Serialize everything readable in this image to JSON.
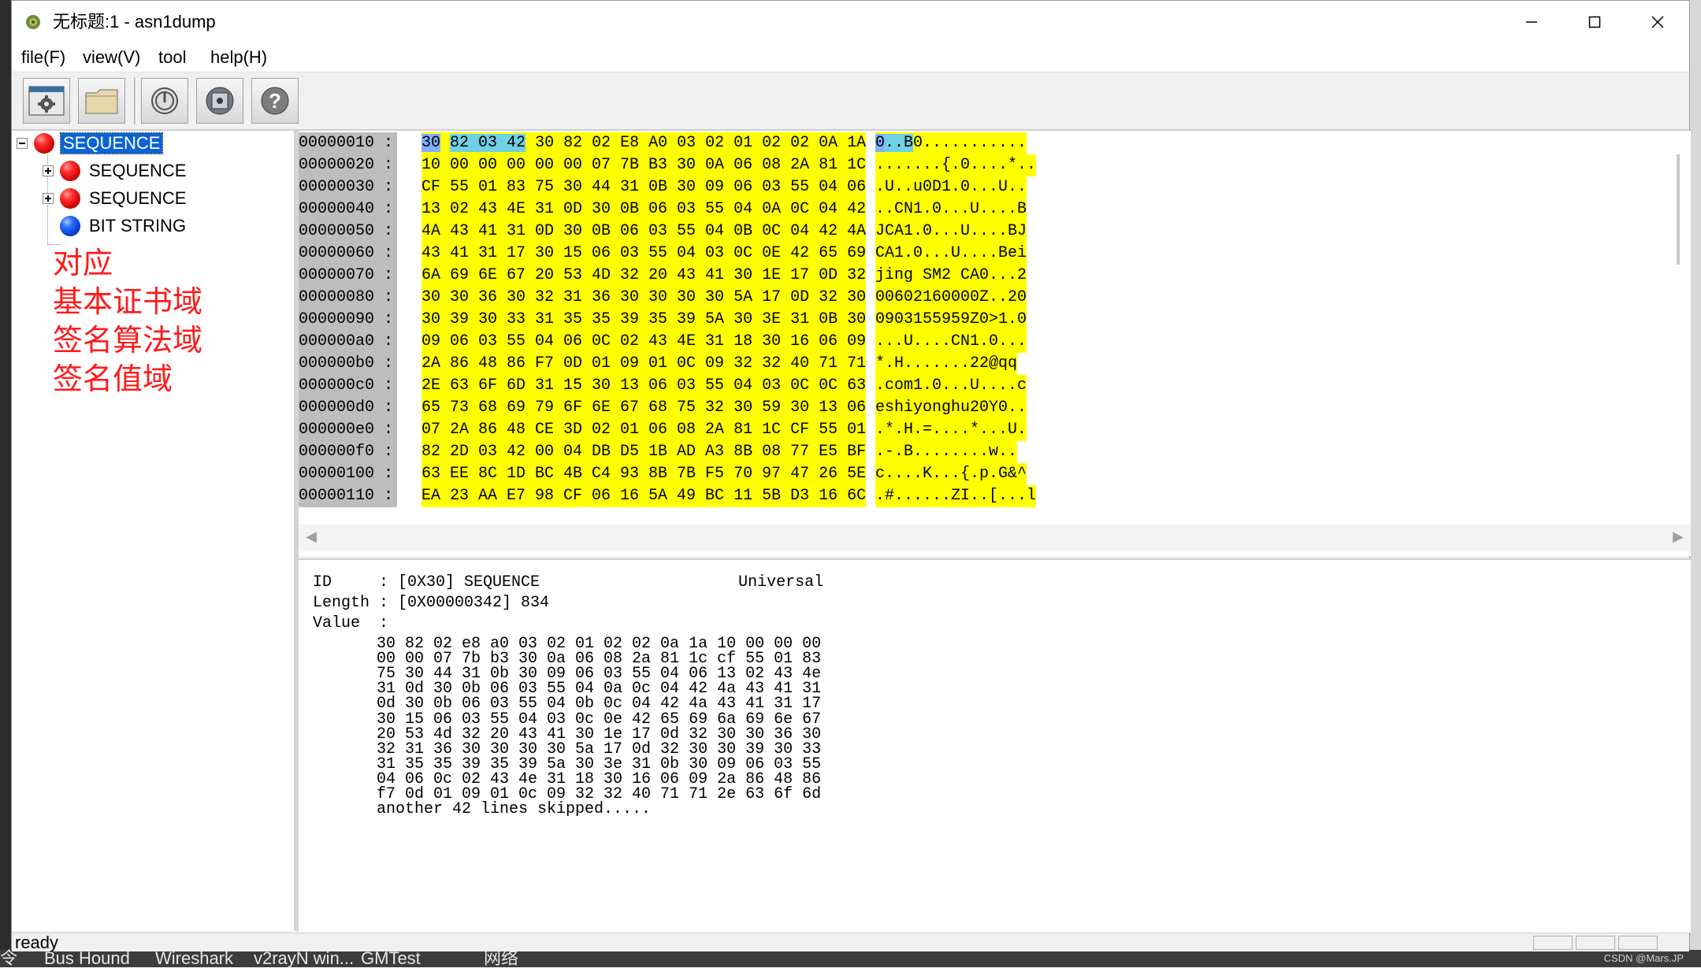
{
  "window": {
    "title": "无标题:1 - asn1dump"
  },
  "menu": [
    {
      "label": "file(F)"
    },
    {
      "label": "view(V)"
    },
    {
      "label": "tool"
    },
    {
      "label": "help(H)"
    }
  ],
  "toolbar": {
    "icons": [
      "window-settings-icon",
      "open-folder-icon",
      "power-icon",
      "disk-icon",
      "help-icon"
    ]
  },
  "tree": {
    "root": {
      "label": "SEQUENCE",
      "icon": "red-ball-icon",
      "expanded": true,
      "selected": true
    },
    "children": [
      {
        "label": "SEQUENCE",
        "icon": "red-ball-icon",
        "expandable": true
      },
      {
        "label": "SEQUENCE",
        "icon": "red-ball-icon",
        "expandable": true
      },
      {
        "label": "BIT STRING",
        "icon": "blue-ball-icon",
        "expandable": false
      }
    ]
  },
  "annotations": [
    "对应",
    "基本证书域",
    "签名算法域",
    "签名值域"
  ],
  "hex": {
    "rows": [
      {
        "addr": "00000010 :",
        "b1": "30",
        "b2": "82 03 42",
        "rest": "30 82 02 E8 A0 03 02 01 02 02 0A 1A",
        "a1": "0",
        "a2": "..B",
        "arest": "0..........."
      },
      {
        "addr": "00000020 :",
        "bytes": "10 00 00 00 00 00 07 7B B3 30 0A 06 08 2A 81 1C",
        "ascii": ".......{.0....*.."
      },
      {
        "addr": "00000030 :",
        "bytes": "CF 55 01 83 75 30 44 31 0B 30 09 06 03 55 04 06",
        "ascii": ".U..u0D1.0...U.."
      },
      {
        "addr": "00000040 :",
        "bytes": "13 02 43 4E 31 0D 30 0B 06 03 55 04 0A 0C 04 42",
        "ascii": "..CN1.0...U....B"
      },
      {
        "addr": "00000050 :",
        "bytes": "4A 43 41 31 0D 30 0B 06 03 55 04 0B 0C 04 42 4A",
        "ascii": "JCA1.0...U....BJ"
      },
      {
        "addr": "00000060 :",
        "bytes": "43 41 31 17 30 15 06 03 55 04 03 0C 0E 42 65 69",
        "ascii": "CA1.0...U....Bei"
      },
      {
        "addr": "00000070 :",
        "bytes": "6A 69 6E 67 20 53 4D 32 20 43 41 30 1E 17 0D 32",
        "ascii": "jing SM2 CA0...2"
      },
      {
        "addr": "00000080 :",
        "bytes": "30 30 36 30 32 31 36 30 30 30 30 5A 17 0D 32 30",
        "ascii": "00602160000Z..20"
      },
      {
        "addr": "00000090 :",
        "bytes": "30 39 30 33 31 35 35 39 35 39 5A 30 3E 31 0B 30",
        "ascii": "0903155959Z0>1.0"
      },
      {
        "addr": "000000a0 :",
        "bytes": "09 06 03 55 04 06 0C 02 43 4E 31 18 30 16 06 09",
        "ascii": "...U....CN1.0..."
      },
      {
        "addr": "000000b0 :",
        "bytes": "2A 86 48 86 F7 0D 01 09 01 0C 09 32 32 40 71 71",
        "ascii": "*.H.......22@qq"
      },
      {
        "addr": "000000c0 :",
        "bytes": "2E 63 6F 6D 31 15 30 13 06 03 55 04 03 0C 0C 63",
        "ascii": ".com1.0...U....c"
      },
      {
        "addr": "000000d0 :",
        "bytes": "65 73 68 69 79 6F 6E 67 68 75 32 30 59 30 13 06",
        "ascii": "eshiyonghu20Y0.."
      },
      {
        "addr": "000000e0 :",
        "bytes": "07 2A 86 48 CE 3D 02 01 06 08 2A 81 1C CF 55 01",
        "ascii": ".*.H.=....*...U."
      },
      {
        "addr": "000000f0 :",
        "bytes": "82 2D 03 42 00 04 DB D5 1B AD A3 8B 08 77 E5 BF",
        "ascii": ".-.B........w.."
      },
      {
        "addr": "00000100 :",
        "bytes": "63 EE 8C 1D BC 4B C4 93 8B 7B F5 70 97 47 26 5E",
        "ascii": "c....K...{.p.G&^"
      },
      {
        "addr": "00000110 :",
        "bytes": "EA 23 AA E7 98 CF 06 16 5A 49 BC 11 5B D3 16 6C",
        "ascii": ".#......ZI..[...l"
      }
    ]
  },
  "detail": {
    "id_line": "ID     : [0X30] SEQUENCE                     Universal",
    "length_line": "Length : [0X00000342] 834",
    "value_line": "Value  :",
    "value_rows": [
      "30 82 02 e8 a0 03 02 01 02 02 0a 1a 10 00 00 00",
      "00 00 07 7b b3 30 0a 06 08 2a 81 1c cf 55 01 83",
      "75 30 44 31 0b 30 09 06 03 55 04 06 13 02 43 4e",
      "31 0d 30 0b 06 03 55 04 0a 0c 04 42 4a 43 41 31",
      "0d 30 0b 06 03 55 04 0b 0c 04 42 4a 43 41 31 17",
      "30 15 06 03 55 04 03 0c 0e 42 65 69 6a 69 6e 67",
      "20 53 4d 32 20 43 41 30 1e 17 0d 32 30 30 36 30",
      "32 31 36 30 30 30 30 5a 17 0d 32 30 30 39 30 33",
      "31 35 35 39 35 39 5a 30 3e 31 0b 30 09 06 03 55",
      "04 06 0c 02 43 4e 31 18 30 16 06 09 2a 86 48 86",
      "f7 0d 01 09 01 0c 09 32 32 40 71 71 2e 63 6f 6d"
    ],
    "skipped": "another 42 lines skipped....."
  },
  "status": {
    "text": "ready"
  },
  "taskbar": {
    "items": [
      "令",
      "Bus Hound",
      "Wireshark",
      "v2rayN win...",
      "GMTest",
      "网络"
    ],
    "watermark": "CSDN @Mars.JP"
  },
  "colors": {
    "hex_highlight": "#ffff00",
    "selection": "#0a64d6",
    "annotation": "#ff1a1a"
  }
}
